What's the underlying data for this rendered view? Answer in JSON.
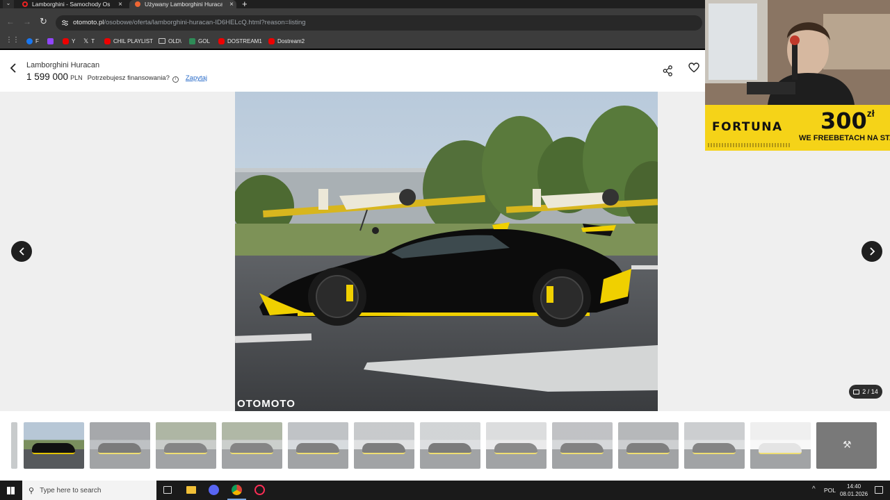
{
  "browser": {
    "tabs": [
      {
        "title": "Lamborghini - Samochody Osobowe",
        "active": false
      },
      {
        "title": "Używany Lamborghini Huracan",
        "active": true
      }
    ],
    "url_host": "otomoto.pl",
    "url_path": "/osobowe/oferta/lamborghini-huracan-ID6HELcQ.html?reason=listing",
    "bookmarks": [
      "F",
      "",
      "Y",
      "T",
      "CHIL PLAYLIST",
      "OLD\\",
      "GOL",
      "DOSTREAM1",
      "Dostream2"
    ]
  },
  "listing": {
    "title": "Lamborghini Huracan",
    "price": "1 599 000",
    "currency": "PLN",
    "financing_question": "Potrzebujesz finansowania?",
    "financing_link": "Zapytaj",
    "watermark": "OTOMOTO",
    "photo_counter": "2 / 14",
    "thumbnail_count": 13,
    "active_thumbnail": 1
  },
  "stream_overlay": {
    "ad_brand": "FORTUNA",
    "ad_amount": "300",
    "ad_currency": "zł",
    "ad_tagline": "WE FREEBETACH NA START"
  },
  "taskbar": {
    "search_placeholder": "Type here to search",
    "language": "POL",
    "time": "14:40",
    "date": "08.01.2026"
  },
  "colors": {
    "accent_link": "#2a6cc9",
    "car_body": "#0c0c0c",
    "car_accent": "#f0d000",
    "ad_yellow": "#f5d318"
  }
}
